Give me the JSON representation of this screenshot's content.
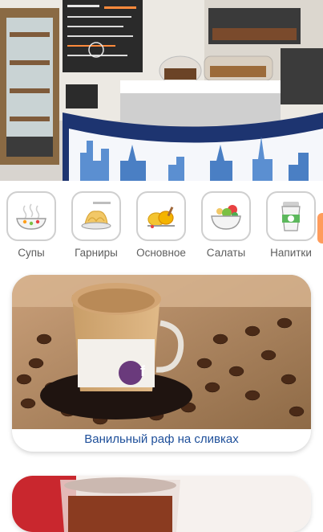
{
  "categories": [
    {
      "label": "Супы",
      "icon": "soup-icon"
    },
    {
      "label": "Гарниры",
      "icon": "pasta-icon"
    },
    {
      "label": "Основное",
      "icon": "main-dish-icon"
    },
    {
      "label": "Салаты",
      "icon": "salad-icon"
    },
    {
      "label": "Напитки",
      "icon": "drink-cup-icon"
    }
  ],
  "products": [
    {
      "title": "Ванильный раф на сливках",
      "cup_logo": "f"
    },
    {
      "title": ""
    }
  ],
  "colors": {
    "accent": "#1e4f9a",
    "category_border": "#cfcfcf",
    "scroll_indicator": "#ff9c5b"
  }
}
